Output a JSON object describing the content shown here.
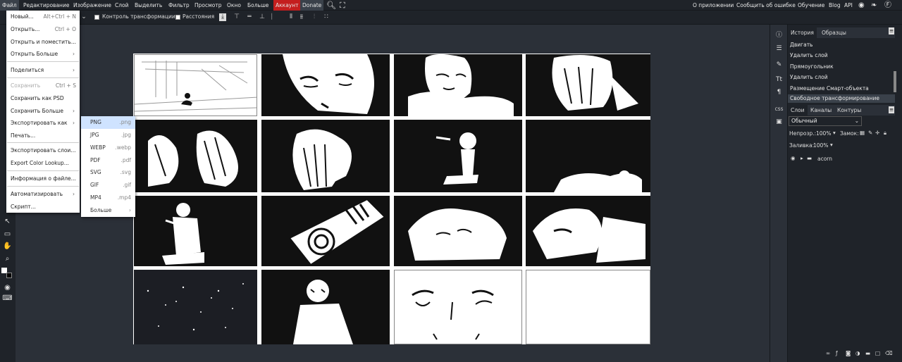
{
  "menubar": {
    "items": [
      "Файл",
      "Редактирование",
      "Изображение",
      "Слой",
      "Выделить",
      "Фильтр",
      "Просмотр",
      "Окно",
      "Больше",
      "Аккаунт",
      "Donate"
    ],
    "right": [
      "О приложении",
      "Сообщить об ошибке",
      "Обучение",
      "Blog",
      "API"
    ]
  },
  "options": {
    "transform_controls": "Контроль трансформации",
    "distances": "Расстояния"
  },
  "file_menu": {
    "items": [
      {
        "label": "Новый...",
        "shortcut": "Alt+Ctrl + N"
      },
      {
        "label": "Открыть...",
        "shortcut": "Ctrl + O"
      },
      {
        "label": "Открыть и поместить..."
      },
      {
        "label": "Открыть Больше"
      },
      {
        "label": "Поделиться"
      },
      {
        "label": "Сохранить",
        "shortcut": "Ctrl + S"
      },
      {
        "label": "Сохранить как PSD"
      },
      {
        "label": "Сохранить Больше"
      },
      {
        "label": "Экспортировать как"
      },
      {
        "label": "Печать..."
      },
      {
        "label": "Экспортировать слои..."
      },
      {
        "label": "Export Color Lookup..."
      },
      {
        "label": "Информация о файле..."
      },
      {
        "label": "Автоматизировать"
      },
      {
        "label": "Скрипт..."
      }
    ]
  },
  "export_submenu": [
    {
      "label": "PNG",
      "ext": ".png"
    },
    {
      "label": "JPG",
      "ext": ".jpg"
    },
    {
      "label": "WEBP",
      "ext": ".webp"
    },
    {
      "label": "PDF",
      "ext": ".pdf"
    },
    {
      "label": "SVG",
      "ext": ".svg"
    },
    {
      "label": "GIF",
      "ext": ".gif"
    },
    {
      "label": "MP4",
      "ext": ".mp4"
    },
    {
      "label": "Больше"
    }
  ],
  "history_panel": {
    "tabs": [
      "История",
      "Образцы"
    ],
    "items": [
      "Двигать",
      "Удалить слой",
      "Прямоугольник",
      "Удалить слой",
      "Размещение Смарт-объекта",
      "Свободное трансформирование"
    ]
  },
  "layers_panel": {
    "tabs": [
      "Слои",
      "Каналы",
      "Контуры"
    ],
    "blend_mode": "Обычный",
    "opacity_label": "Непрозр.:",
    "opacity_value": "100%",
    "lock_label": "Замок:",
    "fill_label": "Заливка:",
    "fill_value": "100%",
    "layers": [
      {
        "name": "acorn"
      }
    ]
  },
  "colors": {
    "account": "#c41e1e",
    "selected_export": "#cfe3ff",
    "panel_bg": "#1f2329"
  }
}
